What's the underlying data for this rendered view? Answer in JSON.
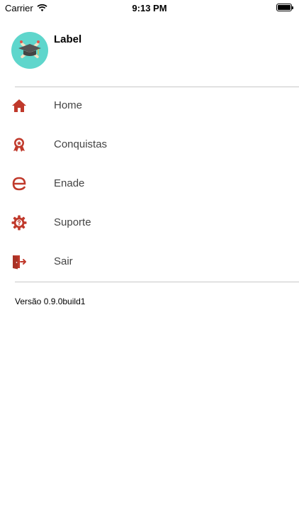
{
  "status_bar": {
    "carrier": "Carrier",
    "time": "9:13 PM"
  },
  "profile": {
    "name": "Label",
    "avatar_icon": "graduation-cap-avatar"
  },
  "menu": [
    {
      "label": "Home",
      "icon": "home-icon"
    },
    {
      "label": "Conquistas",
      "icon": "award-icon"
    },
    {
      "label": "Enade",
      "icon": "e-letter-icon"
    },
    {
      "label": "Suporte",
      "icon": "gear-help-icon"
    },
    {
      "label": "Sair",
      "icon": "exit-door-icon"
    }
  ],
  "footer": {
    "version": "Versão 0.9.0build1"
  },
  "colors": {
    "accent": "#c0392b",
    "avatar_bg": "#5fd6cc",
    "divider": "#c8c8c8"
  }
}
